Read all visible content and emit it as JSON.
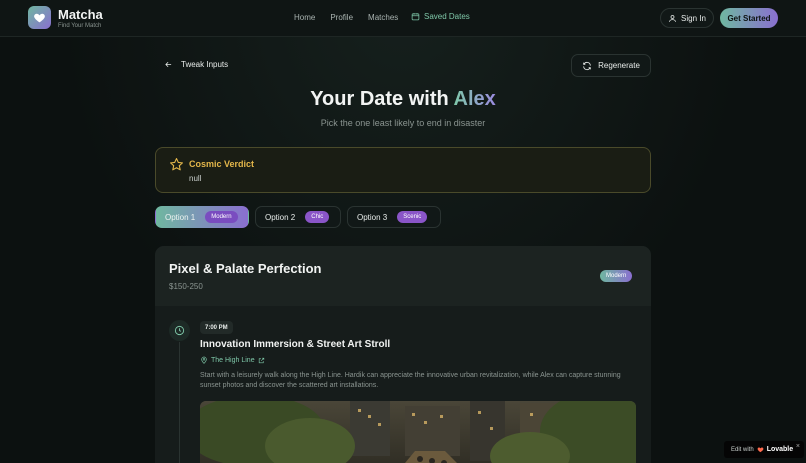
{
  "nav": {
    "brand": "Matcha",
    "tagline": "Find Your Match",
    "links": [
      "Home",
      "Profile",
      "Matches"
    ],
    "saved_label": "Saved Dates",
    "signin_label": "Sign In",
    "cta_label": "Get Started"
  },
  "controls": {
    "back_label": "Tweak Inputs",
    "regen_label": "Regenerate"
  },
  "hero": {
    "title_prefix": "Your Date with ",
    "partner": "Alex",
    "subtitle": "Pick the one least likely to end in disaster"
  },
  "verdict": {
    "title": "Cosmic Verdict",
    "body": "null"
  },
  "options": [
    {
      "label": "Option 1",
      "tag": "Modern",
      "active": true
    },
    {
      "label": "Option 2",
      "tag": "Chic",
      "active": false
    },
    {
      "label": "Option 3",
      "tag": "Scenic",
      "active": false
    }
  ],
  "plan": {
    "title": "Pixel & Palate Perfection",
    "price": "$150-250",
    "badge": "Modern",
    "event": {
      "time": "7:00 PM",
      "title": "Innovation Immersion & Street Art Stroll",
      "location": "The High Line",
      "description": "Start with a leisurely walk along the High Line. Hardik can appreciate the innovative urban revitalization, while Alex can capture stunning sunset photos and discover the scattered art installations."
    }
  },
  "lovable": {
    "prefix": "Edit with",
    "brand": "Lovable",
    "close": "×"
  },
  "colors": {
    "accent_green": "#7fc8a9",
    "accent_purple": "#8a6fd0",
    "verdict_gold": "#e3b64a"
  }
}
